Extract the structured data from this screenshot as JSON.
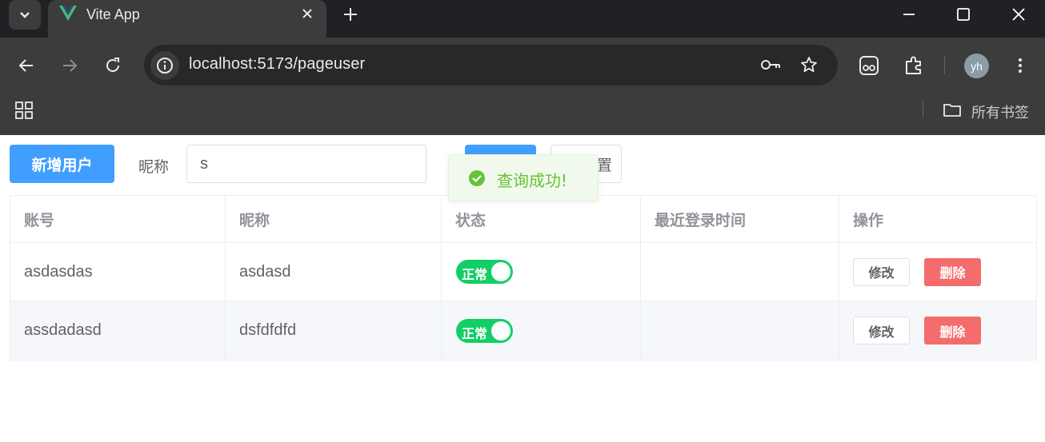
{
  "browser": {
    "tab_title": "Vite App",
    "url": "localhost:5173/pageuser",
    "profile_initials": "yh",
    "bookmarks_label": "所有书签"
  },
  "toolbar": {
    "add_user_label": "新增用户",
    "nickname_label": "昵称",
    "search_value": "s",
    "search_button_label": "",
    "reset_button_label": "置"
  },
  "toast": {
    "message": "查询成功!",
    "type": "success"
  },
  "table": {
    "headers": [
      "账号",
      "昵称",
      "状态",
      "最近登录时间",
      "操作"
    ],
    "rows": [
      {
        "account": "asdasdas",
        "nickname": "asdasd",
        "status": "正常",
        "status_on": true,
        "last_login": "",
        "edit_label": "修改",
        "delete_label": "删除"
      },
      {
        "account": "assdadasd",
        "nickname": "dsfdfdfd",
        "status": "正常",
        "status_on": true,
        "last_login": "",
        "edit_label": "修改",
        "delete_label": "删除"
      }
    ]
  },
  "colors": {
    "primary": "#409eff",
    "success": "#13ce66",
    "danger": "#f56c6c",
    "toast_text": "#67c23a"
  }
}
